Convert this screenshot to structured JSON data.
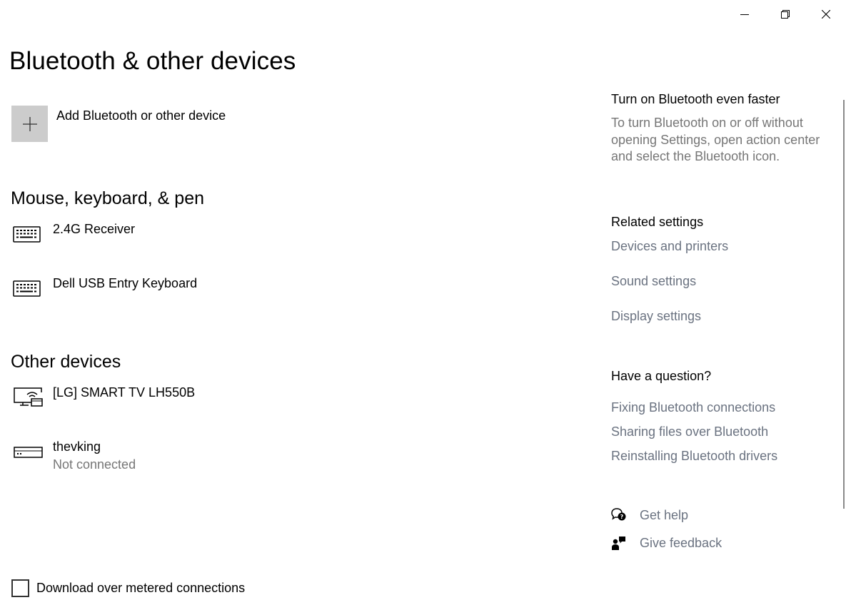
{
  "window": {
    "minimize_icon": "minimize-icon",
    "maximize_icon": "restore-icon",
    "close_icon": "close-icon"
  },
  "page": {
    "title": "Bluetooth & other devices"
  },
  "add_device": {
    "label": "Add Bluetooth or other device",
    "icon": "plus-icon"
  },
  "sections": {
    "mouse_keyboard_pen": {
      "heading": "Mouse, keyboard, & pen",
      "devices": [
        {
          "name": "2.4G Receiver",
          "icon": "keyboard-icon"
        },
        {
          "name": "Dell USB Entry Keyboard",
          "icon": "keyboard-icon"
        }
      ]
    },
    "other_devices": {
      "heading": "Other devices",
      "devices": [
        {
          "name": "[LG] SMART TV LH550B",
          "icon": "display-wireless-icon"
        },
        {
          "name": "thevking",
          "status": "Not connected",
          "icon": "generic-device-icon"
        }
      ]
    }
  },
  "metered": {
    "label": "Download over metered connections",
    "checked": false
  },
  "sidebar": {
    "tip": {
      "heading": "Turn on Bluetooth even faster",
      "body": "To turn Bluetooth on or off without opening Settings, open action center and select the Bluetooth icon."
    },
    "related": {
      "heading": "Related settings",
      "links": [
        "Devices and printers",
        "Sound settings",
        "Display settings"
      ]
    },
    "question": {
      "heading": "Have a question?",
      "links": [
        "Fixing Bluetooth connections",
        "Sharing files over Bluetooth",
        "Reinstalling Bluetooth drivers"
      ]
    },
    "help": {
      "get_help": "Get help",
      "give_feedback": "Give feedback"
    }
  },
  "colors": {
    "link": "#6a7280",
    "secondary_text": "#767676",
    "add_tile": "#cccccc"
  }
}
